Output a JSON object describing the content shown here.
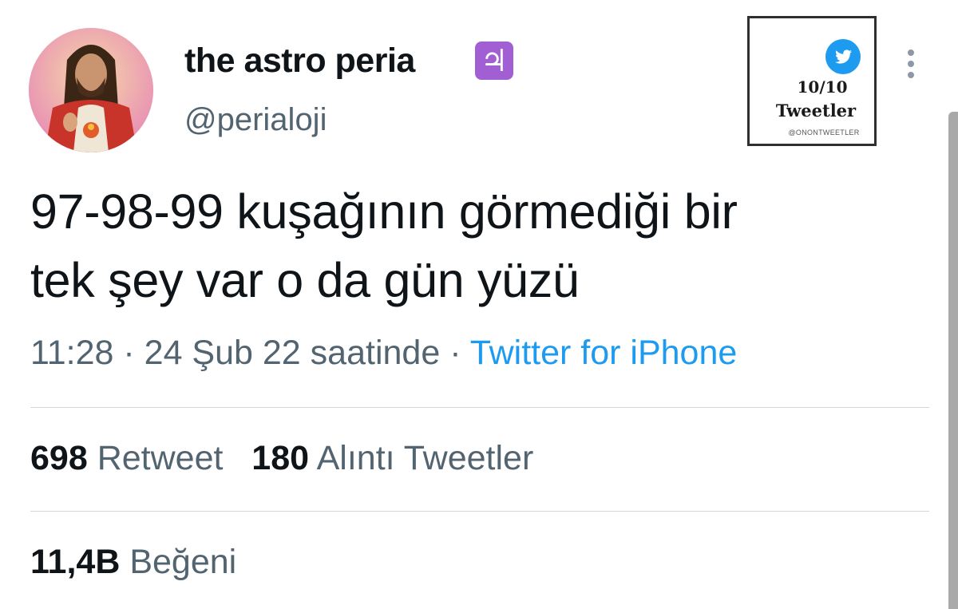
{
  "author": {
    "display_name": "the astro peria",
    "badge_emoji": "♃",
    "handle": "@perialoji",
    "avatar_icon": "avatar-portrait"
  },
  "watermark": {
    "count": "10/10",
    "label": "Tweetler",
    "handle": "@ONONTWEETLER",
    "icon": "twitter-bird-icon"
  },
  "tweet": {
    "text_line1": "97-98-99 kuşağının görmediği bir",
    "text_line2": "tek şey var o da gün yüzü",
    "time": "11:28",
    "separator": "·",
    "date": "24 Şub 22 saatinde",
    "source": "Twitter for iPhone"
  },
  "stats": {
    "retweet_count": "698",
    "retweet_label": "Retweet",
    "quote_count": "180",
    "quote_label": "Alıntı Tweetler",
    "like_count": "11,4B",
    "like_label": "Beğeni"
  },
  "colors": {
    "accent": "#1d9bf0",
    "secondary_text": "#536471",
    "primary_text": "#0f1419",
    "badge": "#a25fd3"
  }
}
